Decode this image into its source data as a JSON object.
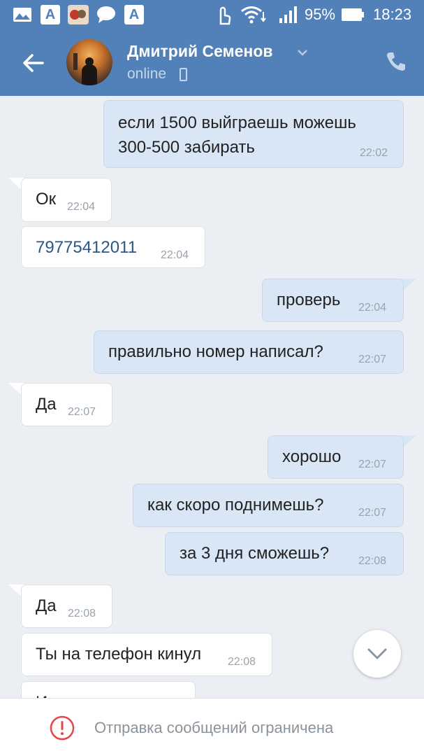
{
  "status_bar": {
    "battery": "95%",
    "time": "18:23",
    "icons": [
      "gallery-icon",
      "font-app-icon",
      "photo-avatar-icon",
      "chat-bubble-icon",
      "font-app-icon",
      "touch-icon",
      "wifi-icon",
      "signal-icon",
      "battery-icon"
    ]
  },
  "header": {
    "name": "Дмитрий Семенов",
    "status": "online",
    "icons": [
      "back-arrow-icon",
      "chevron-down-icon",
      "mobile-device-icon",
      "phone-icon"
    ],
    "accent_color": "#5181b8"
  },
  "messages": [
    {
      "direction": "out",
      "lines": [
        "если 1500 выйграешь можешь",
        "300-500 забирать"
      ],
      "time": "22:02"
    },
    {
      "direction": "in",
      "text": "Ок",
      "time": "22:04"
    },
    {
      "direction": "in",
      "text": "79775412011",
      "time": "22:04",
      "is_link": true
    },
    {
      "direction": "out",
      "text": "проверь",
      "time": "22:04"
    },
    {
      "direction": "out",
      "text": "правильно номер написал?",
      "time": "22:07"
    },
    {
      "direction": "in",
      "text": "Да",
      "time": "22:07"
    },
    {
      "direction": "out",
      "text": "хорошо",
      "time": "22:07"
    },
    {
      "direction": "out",
      "text": "как скоро поднимешь?",
      "time": "22:07"
    },
    {
      "direction": "out",
      "text": "за 3 дня сможешь?",
      "time": "22:08"
    },
    {
      "direction": "in",
      "text": "Да",
      "time": "22:08"
    },
    {
      "direction": "in",
      "text": "Ты на телефон кинул",
      "time": "22:08"
    },
    {
      "direction": "in",
      "text": "Или на карт...",
      "time": ""
    }
  ],
  "bottom_bar": {
    "notice": "Отправка сообщений ограничена",
    "icon": "alert-circle-icon",
    "alert_color": "#e64646"
  },
  "scroll_button_icon": "chevron-down-icon"
}
